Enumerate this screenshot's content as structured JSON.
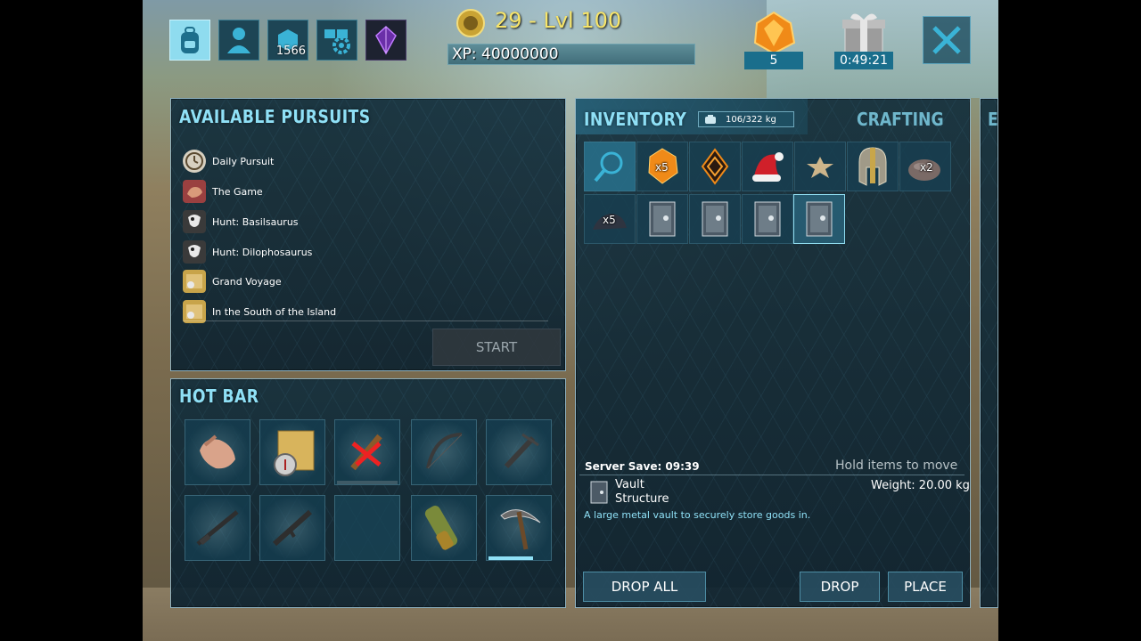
{
  "hud": {
    "level_text": "29 - Lvl 100",
    "xp_text": "XP: 40000000",
    "engrams_count": "1566",
    "element_count": "5",
    "gift_timer": "0:49:21"
  },
  "pursuits": {
    "title": "AVAILABLE PURSUITS",
    "items": [
      {
        "label": "Daily Pursuit"
      },
      {
        "label": "The Game"
      },
      {
        "label": "Hunt: Basilsaurus"
      },
      {
        "label": "Hunt: Dilophosaurus"
      },
      {
        "label": "Grand Voyage"
      },
      {
        "label": "In the South of the Island"
      }
    ],
    "start_label": "START"
  },
  "hotbar": {
    "title": "HOT BAR"
  },
  "inventory": {
    "title": "INVENTORY",
    "weight": "106/322 kg",
    "crafting_tab": "CRAFTING",
    "next_tab_partial": "E",
    "slots_row1": [
      {
        "icon": "search-icon",
        "qty": ""
      },
      {
        "icon": "amber-gem-icon",
        "qty": "x5"
      },
      {
        "icon": "orange-crystal-icon",
        "qty": ""
      },
      {
        "icon": "santa-hat-icon",
        "qty": ""
      },
      {
        "icon": "starfish-icon",
        "qty": ""
      },
      {
        "icon": "metal-helmet-icon",
        "qty": ""
      },
      {
        "icon": "stone-icon",
        "qty": "x2"
      }
    ],
    "slots_row2": [
      {
        "icon": "hide-icon",
        "qty": "x5"
      },
      {
        "icon": "vault-icon",
        "qty": ""
      },
      {
        "icon": "vault-icon",
        "qty": ""
      },
      {
        "icon": "vault-icon",
        "qty": ""
      },
      {
        "icon": "vault-icon",
        "qty": ""
      }
    ],
    "server_save": "Server Save: 09:39",
    "hold_hint": "Hold items to move",
    "selected_item_name": "Vault\nStructure",
    "selected_item_weight": "Weight: 20.00 kg",
    "selected_item_desc": "A large metal vault to securely store goods in.",
    "drop_all_label": "DROP ALL",
    "drop_label": "DROP",
    "place_label": "PLACE"
  },
  "colors": {
    "accent": "#8fe0f6",
    "gold": "#f7e56a",
    "panel_border": "#8fb3c2"
  }
}
